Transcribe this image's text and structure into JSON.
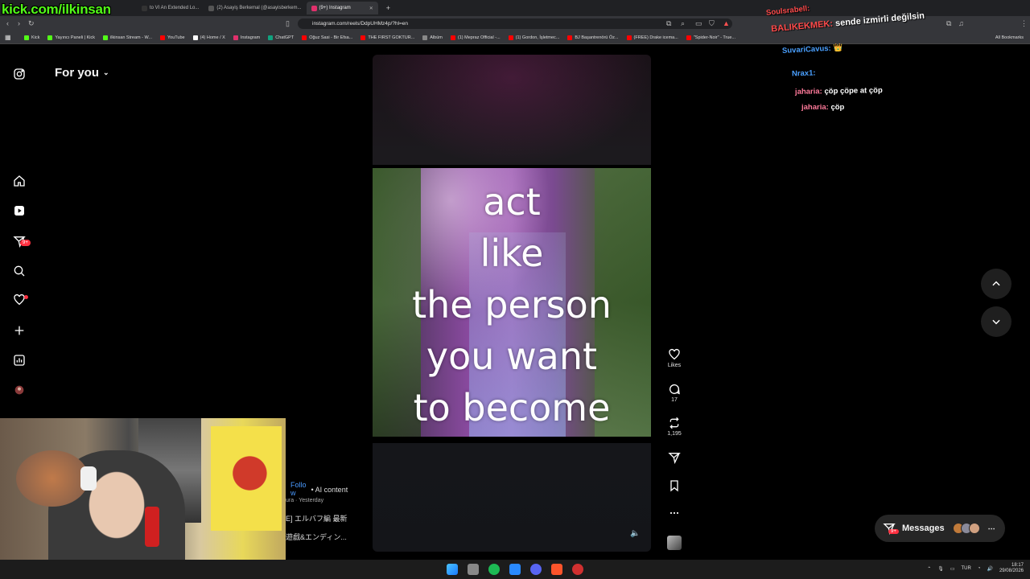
{
  "overlay": {
    "channel_url": "kick.com/ilkinsan"
  },
  "browser": {
    "tabs": [
      {
        "label": "to VI An Extended Lo...",
        "color": "#333",
        "active": false
      },
      {
        "label": "(2) Asayiş Berkemal (@asayisberkem...",
        "color": "#555",
        "active": false
      },
      {
        "label": "(9+) Instagram",
        "color": "#e1306c",
        "active": true
      }
    ],
    "new_tab": "+",
    "url": "instagram.com/reels/DdpUHMz4p/?hl=en",
    "bookmarks": [
      {
        "label": "Kick",
        "color": "#53fc18"
      },
      {
        "label": "Yayıncı Paneli | Kick",
        "color": "#53fc18"
      },
      {
        "label": "ilkinsan Stream - W...",
        "color": "#53fc18"
      },
      {
        "label": "YouTube",
        "color": "#ff0000"
      },
      {
        "label": "(4) Home / X",
        "color": "#ffffff"
      },
      {
        "label": "Instagram",
        "color": "#e1306c"
      },
      {
        "label": "ChatGPT",
        "color": "#10a37f"
      },
      {
        "label": "Oğuz Sasi - Bir Efsa...",
        "color": "#ff0000"
      },
      {
        "label": "THE FIRST GOKTUR...",
        "color": "#ff0000"
      },
      {
        "label": "Albüm",
        "color": "#888888"
      },
      {
        "label": "(1) Mepraz Official -...",
        "color": "#ff0000"
      },
      {
        "label": "(1) Gordon, İşletmec...",
        "color": "#ff0000"
      },
      {
        "label": "BJ Başantrenörü Öz...",
        "color": "#ff0000"
      },
      {
        "label": "(FREE) Drake icema...",
        "color": "#ff0000"
      },
      {
        "label": "\"Spider-Noir\" - True...",
        "color": "#ff0000"
      }
    ],
    "all_bookmarks": "All Bookmarks"
  },
  "instagram": {
    "header": {
      "title": "For you"
    },
    "sidebar": {
      "notifications_badge": "9+"
    },
    "reel": {
      "quote_lines": [
        "act",
        "like",
        "the person",
        "you want",
        "to become"
      ],
      "likes_label": "Likes",
      "comments_count": "17",
      "reposts_count": "1,195",
      "follow_label": "Follo\nw",
      "ai_label": "• AI content",
      "time_label": "ura · Yesterday",
      "caption1": "E] エルバフ編 最新",
      "caption2": "遊戯&エンディン..."
    },
    "messages": {
      "label": "Messages",
      "badge": "9+"
    }
  },
  "chat": [
    {
      "nick": "Soulsrabell:",
      "text": "",
      "color": "#ff4a4a"
    },
    {
      "nick": "BALIKEKMEK:",
      "text": "sende izmirli değilsin",
      "color": "#ff4a4a"
    },
    {
      "nick": "SuvariCavus:",
      "text": "👑",
      "color": "#4aa0ff"
    },
    {
      "nick": "Nrax1:",
      "text": "",
      "color": "#4aa0ff"
    },
    {
      "nick": "jaharia:",
      "text": "çöp çöpe at çöp",
      "color": "#ff7a9a"
    },
    {
      "nick": "jaharia:",
      "text": "çöp",
      "color": "#ff7a9a"
    }
  ],
  "taskbar": {
    "lang": "TUR",
    "time": "18:17",
    "date": "29/08/2026"
  }
}
